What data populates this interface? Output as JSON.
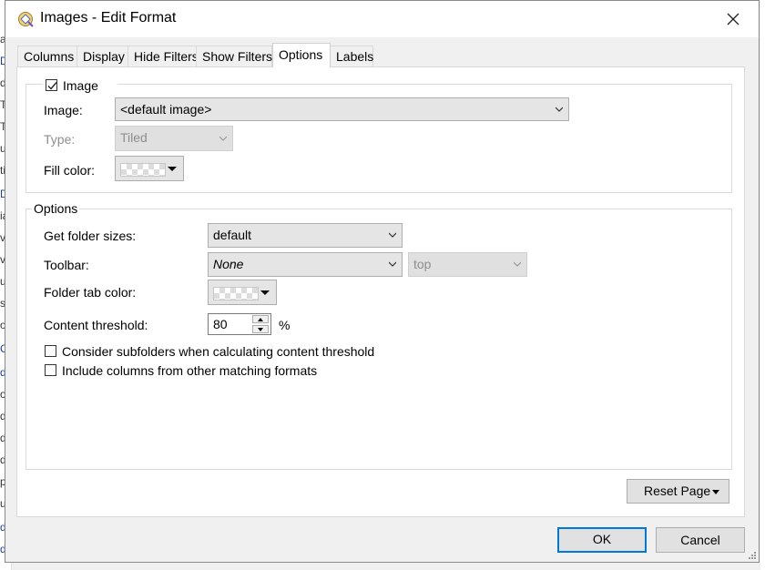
{
  "background_fragments": [
    "al",
    "D",
    "d",
    "T",
    "T",
    "us",
    "tic",
    "D",
    "ia",
    "ve",
    "ve",
    "ur",
    "s",
    "olt",
    "C",
    "de",
    "o",
    "de",
    "de",
    "de",
    "pa",
    "u",
    "de",
    "de"
  ],
  "window": {
    "title": "Images - Edit Format",
    "icon": "app-folder-icon",
    "close_icon": "close-icon"
  },
  "tabs": [
    {
      "label": "Columns",
      "active": false
    },
    {
      "label": "Display",
      "active": false
    },
    {
      "label": "Hide Filters",
      "active": false
    },
    {
      "label": "Show Filters",
      "active": false
    },
    {
      "label": "Options",
      "active": true
    },
    {
      "label": "Labels",
      "active": false
    }
  ],
  "image_group": {
    "checkbox_label": "Image",
    "checked": true,
    "image_label": "Image:",
    "image_value": "<default image>",
    "type_label": "Type:",
    "type_value": "Tiled",
    "fill_color_label": "Fill color:"
  },
  "options_group": {
    "legend": "Options",
    "folder_sizes_label": "Get folder sizes:",
    "folder_sizes_value": "default",
    "toolbar_label": "Toolbar:",
    "toolbar_value": "None",
    "toolbar_position_value": "top",
    "folder_tab_color_label": "Folder tab color:",
    "content_threshold_label": "Content threshold:",
    "content_threshold_value": "80",
    "content_threshold_unit": "%",
    "subfolders_checkbox_label": "Consider subfolders when calculating content threshold",
    "subfolders_checked": false,
    "include_columns_checkbox_label": "Include columns from other matching formats",
    "include_columns_checked": false
  },
  "buttons": {
    "reset_page": "Reset Page",
    "ok": "OK",
    "cancel": "Cancel"
  },
  "colors": {
    "accent": "#0078d7",
    "window_bg": "#f0f0f0",
    "panel_bg": "#ffffff",
    "control_bg": "#e5e5e5",
    "disabled_text": "#8e8e8e"
  }
}
